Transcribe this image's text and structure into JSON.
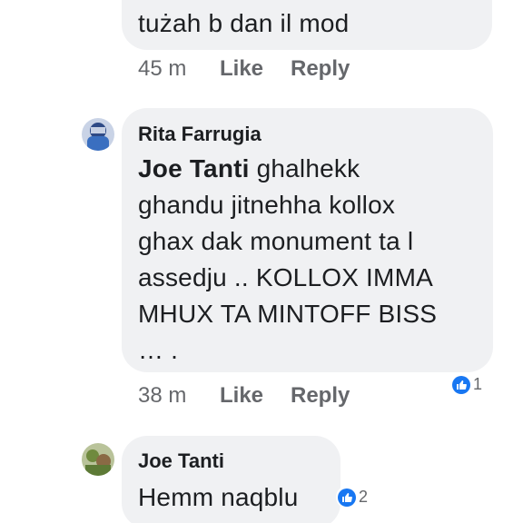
{
  "comments": [
    {
      "text": "tużah b dan il mod",
      "time": "45 m",
      "like_label": "Like",
      "reply_label": "Reply"
    },
    {
      "author": "Rita Farrugia",
      "mention": "Joe Tanti",
      "lines": [
        " ghalhekk",
        "ghandu jitnehha kollox",
        "ghax dak monument ta l",
        "assedju  .. KOLLOX IMMA",
        "MHUX TA MINTOFF BISS",
        "… ."
      ],
      "time": "38 m",
      "like_label": "Like",
      "reply_label": "Reply",
      "reaction_icon": "like-reaction-icon",
      "reaction_count": "1"
    },
    {
      "author": "Joe Tanti",
      "text": "Hemm naqblu",
      "reaction_icon": "like-reaction-icon",
      "reaction_count": "2"
    }
  ],
  "colors": {
    "bubble": "#f0f1f3",
    "meta_text": "#65676b",
    "like_blue": "#1877f2",
    "text": "#1c1e21"
  }
}
